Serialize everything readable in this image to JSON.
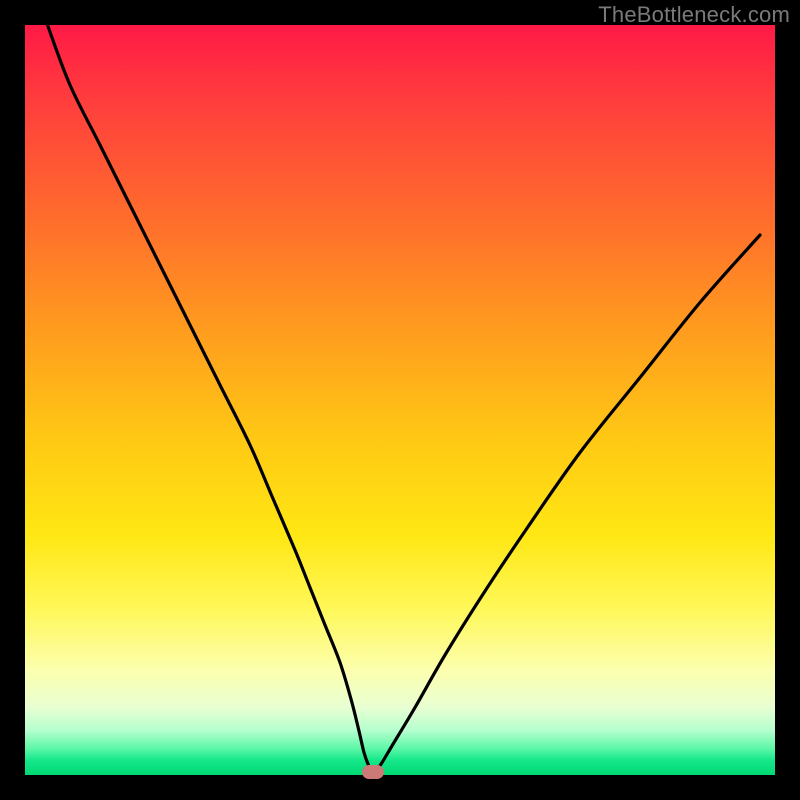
{
  "watermark": "TheBottleneck.com",
  "colors": {
    "frame": "#000000",
    "curve": "#000000",
    "marker": "#cc7a78",
    "gradient_top": "#ff1a46",
    "gradient_bottom": "#00d873"
  },
  "chart_data": {
    "type": "line",
    "title": "",
    "xlabel": "",
    "ylabel": "",
    "xlim": [
      0,
      100
    ],
    "ylim": [
      0,
      100
    ],
    "grid": false,
    "legend": false,
    "series": [
      {
        "name": "bottleneck-curve",
        "x": [
          3,
          6,
          10,
          14,
          18,
          22,
          26,
          30,
          33,
          36,
          38,
          40,
          42,
          43.5,
          44.5,
          45.2,
          45.8,
          46.2,
          46.6,
          47.5,
          49,
          52,
          56,
          61,
          67,
          74,
          82,
          90,
          98
        ],
        "values": [
          100,
          92,
          84,
          76,
          68,
          60,
          52,
          44,
          37,
          30,
          25,
          20,
          15,
          10,
          6,
          3,
          1.3,
          0.5,
          0.4,
          1.5,
          4,
          9,
          16,
          24,
          33,
          43,
          53,
          63,
          72
        ]
      }
    ],
    "marker": {
      "x": 46.4,
      "y": 0.35
    },
    "annotations": []
  }
}
